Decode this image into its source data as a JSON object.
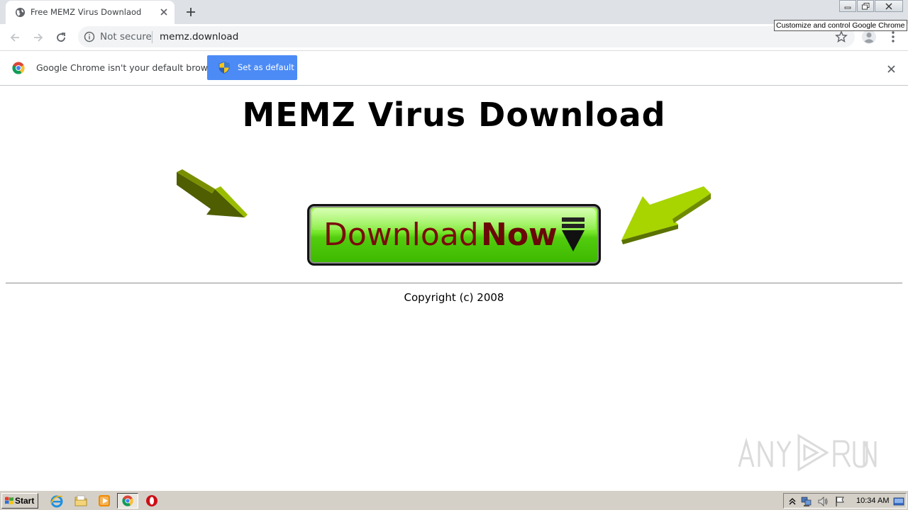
{
  "browser": {
    "tab": {
      "title": "Free MEMZ Virus Downlaod",
      "favicon": "globe-icon"
    },
    "address_bar": {
      "security_label": "Not secure",
      "url": "memz.download"
    },
    "tooltip": "Customize and control Google Chrome"
  },
  "infobar": {
    "message": "Google Chrome isn't your default browser",
    "button_label": "Set as default"
  },
  "page": {
    "heading": "MEMZ Virus Download",
    "download_button": {
      "word1": "Download",
      "word2": "Now"
    },
    "copyright": "Copyright (c) 2008",
    "watermark": "ANY RUN"
  },
  "taskbar": {
    "start_label": "Start",
    "clock": "10:34 AM",
    "apps": [
      "internet-explorer-icon",
      "folder-icon",
      "media-player-icon",
      "chrome-icon",
      "opera-icon"
    ]
  },
  "colors": {
    "button_green": "#5ed41a",
    "button_text": "#7a0c0c",
    "arrow_dark": "#4e5e00",
    "arrow_light": "#b6e000",
    "chrome_blue": "#4c8bf5"
  }
}
